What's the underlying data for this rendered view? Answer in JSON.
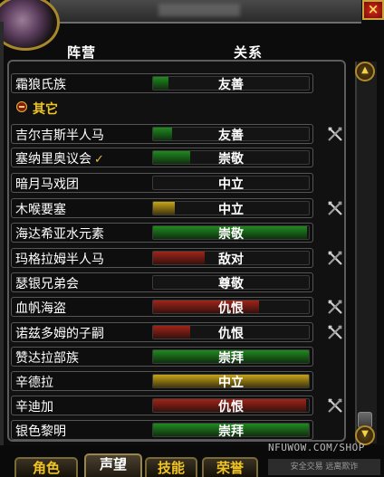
{
  "window": {
    "close_glyph": "×",
    "portrait_icon": "character-portrait"
  },
  "columns": {
    "faction": "阵营",
    "standing": "关系"
  },
  "group": {
    "label": "其它",
    "collapse_icon": "minus-icon"
  },
  "factions": [
    {
      "name": "霜狼氏族",
      "standing": "友善",
      "level": 0.1,
      "color": "#1f8a1f",
      "at_war_toggle": false,
      "watched": false
    },
    {
      "name": "吉尔吉斯半人马",
      "standing": "友善",
      "level": 0.12,
      "color": "#1f8a1f",
      "at_war_toggle": true,
      "watched": false
    },
    {
      "name": "塞纳里奥议会",
      "standing": "崇敬",
      "level": 0.24,
      "color": "#1f8a1f",
      "at_war_toggle": false,
      "watched": true,
      "watched_glyph": "✓"
    },
    {
      "name": "暗月马戏团",
      "standing": "中立",
      "level": 0.0,
      "color": "#c8a418",
      "at_war_toggle": false,
      "watched": false
    },
    {
      "name": "木喉要塞",
      "standing": "中立",
      "level": 0.14,
      "color": "#c8a418",
      "at_war_toggle": true,
      "watched": false
    },
    {
      "name": "海达希亚水元素",
      "standing": "崇敬",
      "level": 0.99,
      "color": "#1f8a1f",
      "at_war_toggle": false,
      "watched": false
    },
    {
      "name": "玛格拉姆半人马",
      "standing": "敌对",
      "level": 0.33,
      "color": "#a02418",
      "at_war_toggle": true,
      "watched": false
    },
    {
      "name": "瑟银兄弟会",
      "standing": "尊敬",
      "level": 0.0,
      "color": "#1f8a1f",
      "at_war_toggle": false,
      "watched": false
    },
    {
      "name": "血帆海盗",
      "standing": "仇恨",
      "level": 0.68,
      "color": "#a02418",
      "at_war_toggle": true,
      "watched": false
    },
    {
      "name": "诺兹多姆的子嗣",
      "standing": "仇恨",
      "level": 0.24,
      "color": "#a02418",
      "at_war_toggle": true,
      "watched": false
    },
    {
      "name": "赞达拉部族",
      "standing": "崇拜",
      "level": 1.0,
      "color": "#1f8a1f",
      "at_war_toggle": false,
      "watched": false
    },
    {
      "name": "辛德拉",
      "standing": "中立",
      "level": 1.0,
      "color": "#c8a418",
      "at_war_toggle": false,
      "watched": false
    },
    {
      "name": "辛迪加",
      "standing": "仇恨",
      "level": 0.98,
      "color": "#a02418",
      "at_war_toggle": true,
      "watched": false
    },
    {
      "name": "银色黎明",
      "standing": "崇拜",
      "level": 1.0,
      "color": "#1f8a1f",
      "at_war_toggle": false,
      "watched": false
    }
  ],
  "tabs": [
    {
      "label": "角色"
    },
    {
      "label": "声望"
    },
    {
      "label": "技能"
    },
    {
      "label": "荣誉"
    }
  ],
  "watermark": {
    "text": "NFUWOW.COM/SHOP",
    "sub": "安全交易 远离欺诈"
  }
}
